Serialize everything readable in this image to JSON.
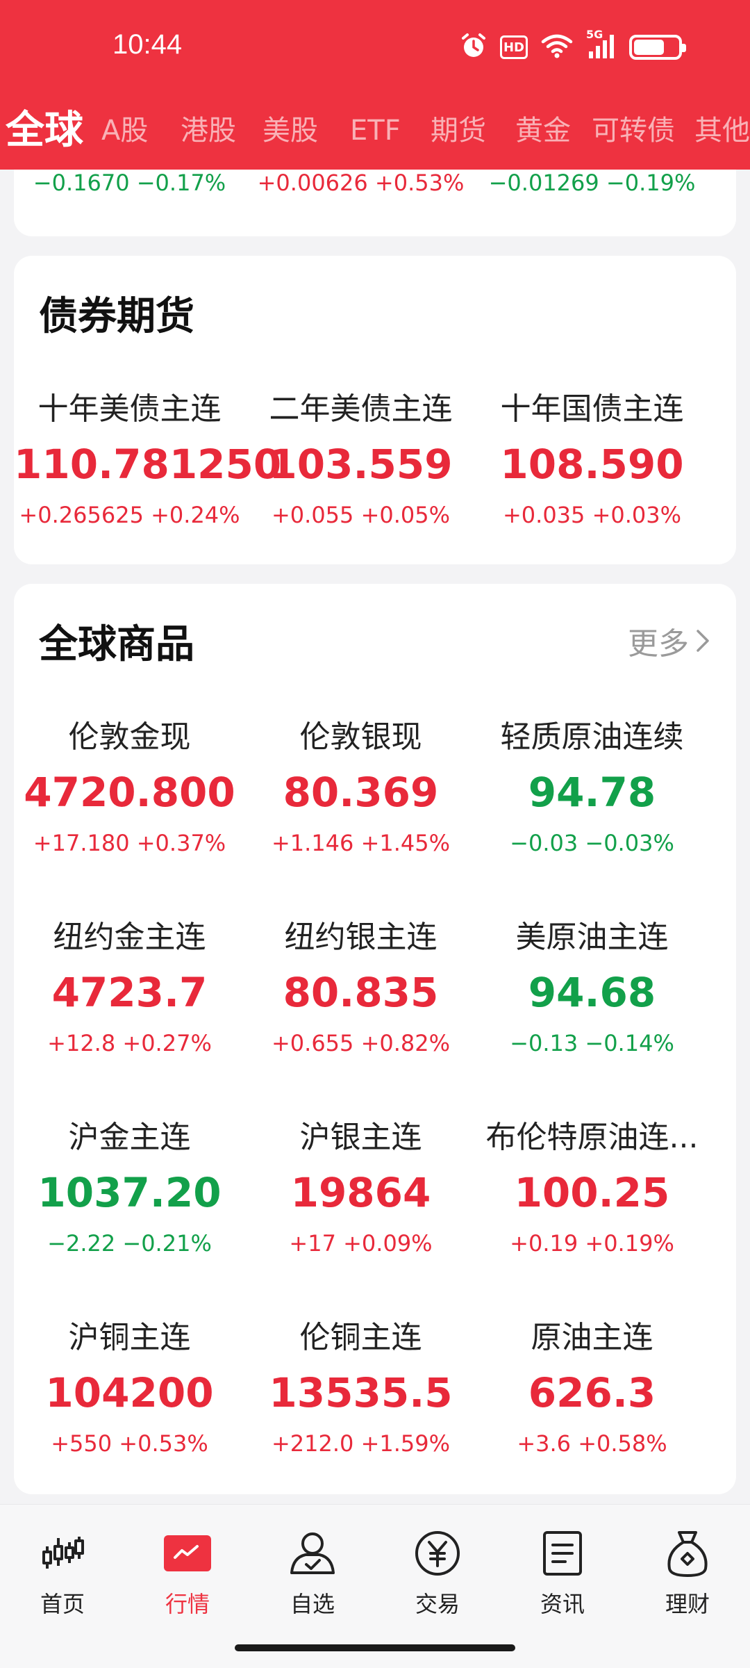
{
  "status_bar": {
    "time": "10:44",
    "hd": "HD",
    "network": "5G",
    "battery_level": 0.7
  },
  "tabs": [
    {
      "label": "全球",
      "active": true
    },
    {
      "label": "A股",
      "active": false
    },
    {
      "label": "港股",
      "active": false
    },
    {
      "label": "美股",
      "active": false
    },
    {
      "label": "ETF",
      "active": false
    },
    {
      "label": "期货",
      "active": false
    },
    {
      "label": "黄金",
      "active": false
    },
    {
      "label": "可转债",
      "active": false
    },
    {
      "label": "其他",
      "active": false
    }
  ],
  "partial_row": [
    {
      "change": "−0.1670 −0.17%",
      "trend": "down"
    },
    {
      "change": "+0.00626 +0.53%",
      "trend": "up"
    },
    {
      "change": "−0.01269 −0.19%",
      "trend": "down"
    }
  ],
  "bond_futures": {
    "title": "债券期货",
    "items": [
      {
        "name": "十年美债主连",
        "price": "110.781250",
        "change": "+0.265625 +0.24%",
        "trend": "up"
      },
      {
        "name": "二年美债主连",
        "price": "103.559",
        "change": "+0.055 +0.05%",
        "trend": "up"
      },
      {
        "name": "十年国债主连",
        "price": "108.590",
        "change": "+0.035 +0.03%",
        "trend": "up"
      }
    ]
  },
  "global_commodities": {
    "title": "全球商品",
    "more": "更多",
    "items": [
      {
        "name": "伦敦金现",
        "price": "4720.800",
        "change": "+17.180 +0.37%",
        "trend": "up"
      },
      {
        "name": "伦敦银现",
        "price": "80.369",
        "change": "+1.146 +1.45%",
        "trend": "up"
      },
      {
        "name": "轻质原油连续",
        "price": "94.78",
        "change": "−0.03 −0.03%",
        "trend": "down"
      },
      {
        "name": "纽约金主连",
        "price": "4723.7",
        "change": "+12.8 +0.27%",
        "trend": "up"
      },
      {
        "name": "纽约银主连",
        "price": "80.835",
        "change": "+0.655 +0.82%",
        "trend": "up"
      },
      {
        "name": "美原油主连",
        "price": "94.68",
        "change": "−0.13 −0.14%",
        "trend": "down"
      },
      {
        "name": "沪金主连",
        "price": "1037.20",
        "change": "−2.22 −0.21%",
        "trend": "down"
      },
      {
        "name": "沪银主连",
        "price": "19864",
        "change": "+17 +0.09%",
        "trend": "up"
      },
      {
        "name": "布伦特原油连...",
        "price": "100.25",
        "change": "+0.19 +0.19%",
        "trend": "up"
      },
      {
        "name": "沪铜主连",
        "price": "104200",
        "change": "+550 +0.53%",
        "trend": "up"
      },
      {
        "name": "伦铜主连",
        "price": "13535.5",
        "change": "+212.0 +1.59%",
        "trend": "up"
      },
      {
        "name": "原油主连",
        "price": "626.3",
        "change": "+3.6 +0.58%",
        "trend": "up"
      }
    ]
  },
  "bottom_nav": [
    {
      "label": "首页",
      "icon": "candlestick-icon",
      "active": false
    },
    {
      "label": "行情",
      "icon": "market-chart-icon",
      "active": true
    },
    {
      "label": "自选",
      "icon": "user-check-icon",
      "active": false
    },
    {
      "label": "交易",
      "icon": "yen-circle-icon",
      "active": false
    },
    {
      "label": "资讯",
      "icon": "document-icon",
      "active": false
    },
    {
      "label": "理财",
      "icon": "money-bag-icon",
      "active": false
    }
  ],
  "colors": {
    "brand_red": "#ee3240",
    "up": "#e8293a",
    "down": "#12a04a"
  }
}
